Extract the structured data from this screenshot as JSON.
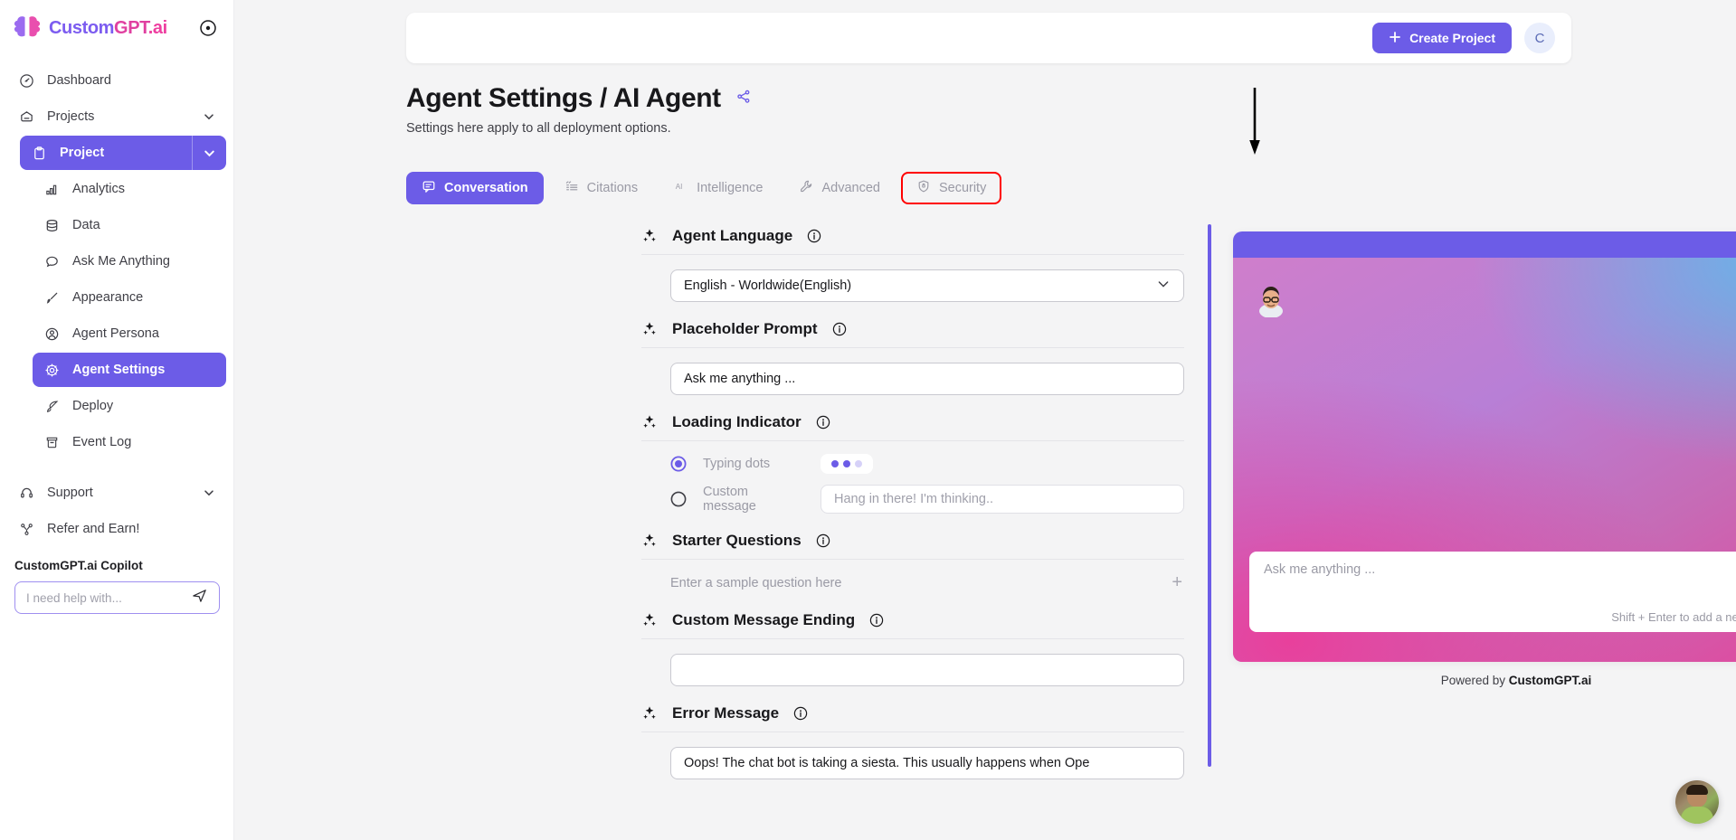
{
  "brand": {
    "name_part1": "Custom",
    "name_part2": "GPT",
    "name_part3": ".ai",
    "logo_icon": "brain-logo-icon",
    "collapse_icon": "collapse-sidebar-icon"
  },
  "sidebar": {
    "items": [
      {
        "label": "Dashboard",
        "icon": "gauge-icon",
        "level": "top",
        "state": "default",
        "chevron": false
      },
      {
        "label": "Projects",
        "icon": "folder-icon",
        "level": "top",
        "state": "default",
        "chevron": true
      },
      {
        "label": "Project",
        "icon": "clipboard-icon",
        "level": "top",
        "state": "active-split",
        "chevron": true
      },
      {
        "label": "Analytics",
        "icon": "bar-chart-icon",
        "level": "sub",
        "state": "default",
        "chevron": false
      },
      {
        "label": "Data",
        "icon": "database-icon",
        "level": "sub",
        "state": "default",
        "chevron": false
      },
      {
        "label": "Ask Me Anything",
        "icon": "chat-bubble-icon",
        "level": "sub",
        "state": "default",
        "chevron": false
      },
      {
        "label": "Appearance",
        "icon": "brush-icon",
        "level": "sub",
        "state": "default",
        "chevron": false
      },
      {
        "label": "Agent Persona",
        "icon": "user-circle-icon",
        "level": "sub",
        "state": "default",
        "chevron": false
      },
      {
        "label": "Agent Settings",
        "icon": "gear-icon",
        "level": "sub",
        "state": "selected",
        "chevron": false
      },
      {
        "label": "Deploy",
        "icon": "rocket-icon",
        "level": "sub",
        "state": "default",
        "chevron": false
      },
      {
        "label": "Event Log",
        "icon": "archive-icon",
        "level": "sub",
        "state": "default",
        "chevron": false
      },
      {
        "label": "Support",
        "icon": "headset-icon",
        "level": "top",
        "state": "default",
        "chevron": true
      },
      {
        "label": "Refer and Earn!",
        "icon": "share-nodes-icon",
        "level": "top",
        "state": "default",
        "chevron": false
      }
    ],
    "copilot": {
      "title": "CustomGPT.ai Copilot",
      "placeholder": "I need help with...",
      "value": "",
      "send_icon": "paper-plane-icon"
    }
  },
  "topbar": {
    "create_label": "Create Project",
    "create_icon": "plus-icon",
    "avatar_initial": "C"
  },
  "page": {
    "title": "Agent Settings / AI Agent",
    "share_icon": "share-icon",
    "subtitle": "Settings here apply to all deployment options."
  },
  "tabs": [
    {
      "label": "Conversation",
      "icon": "chat-box-icon",
      "state": "active"
    },
    {
      "label": "Citations",
      "icon": "citation-icon",
      "state": "default"
    },
    {
      "label": "Intelligence",
      "icon": "ai-text-icon",
      "state": "default"
    },
    {
      "label": "Advanced",
      "icon": "wrench-icon",
      "state": "default"
    },
    {
      "label": "Security",
      "icon": "shield-lock-icon",
      "state": "highlighted"
    }
  ],
  "annotation": {
    "arrow_icon": "down-arrow-annotation",
    "highlight_color": "#ff0000",
    "target": "Security"
  },
  "settings": {
    "sparkle_icon": "sparkle-icon",
    "info_icon": "info-circle-icon",
    "sections": [
      {
        "title": "Agent Language",
        "type": "select",
        "value": "English - Worldwide(English)",
        "chevron_icon": "chevron-down-icon"
      },
      {
        "title": "Placeholder Prompt",
        "type": "text",
        "value": "Ask me anything ...",
        "placeholder": ""
      },
      {
        "title": "Loading Indicator",
        "type": "radio-group",
        "options": [
          {
            "label": "Typing dots",
            "selected": true
          },
          {
            "label": "Custom message",
            "selected": false
          }
        ],
        "custom_message_placeholder": "Hang in there! I'm thinking.."
      },
      {
        "title": "Starter Questions",
        "type": "add-row",
        "placeholder": "Enter a sample question here",
        "add_icon": "plus-icon"
      },
      {
        "title": "Custom Message Ending",
        "type": "text",
        "value": "",
        "placeholder": ""
      },
      {
        "title": "Error Message",
        "type": "text",
        "value": "Oops! The chat bot is taking a siesta. This usually happens when Ope",
        "placeholder": ""
      }
    ]
  },
  "preview": {
    "close_icon": "close-icon",
    "agent_avatar_icon": "agent-avatar-image",
    "input_placeholder": "Ask me anything ...",
    "input_hint": "Shift + Enter to add a new line",
    "send_icon": "paper-plane-icon",
    "powered_prefix": "Powered by ",
    "powered_brand": "CustomGPT.ai",
    "accent_color": "#6c5ce7"
  },
  "floating_widget": {
    "icon": "support-agent-avatar"
  }
}
